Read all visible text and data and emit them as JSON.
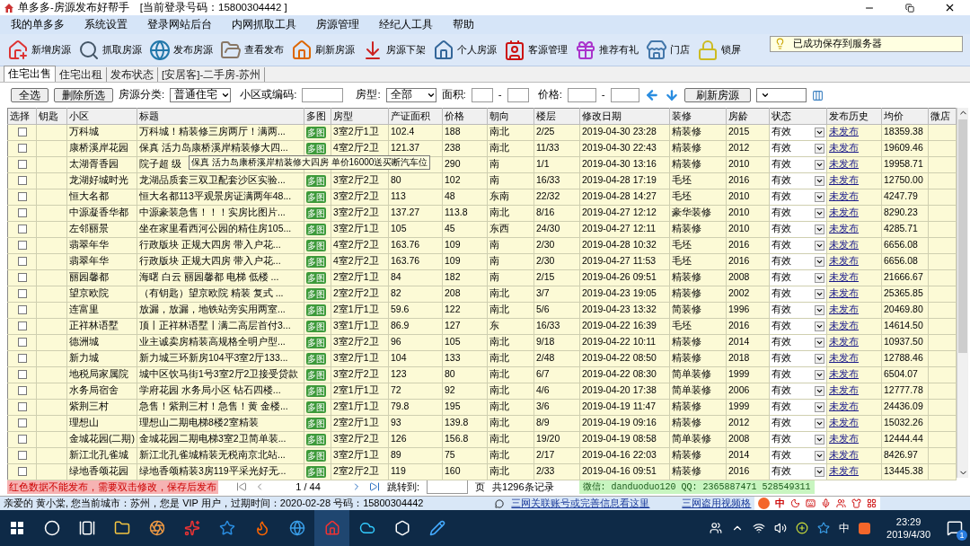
{
  "window": {
    "title": "单多多-房源发布好帮手",
    "login": "[当前登录号码：15800304442 ]"
  },
  "menu": [
    "我的单多多",
    "系统设置",
    "登录网站后台",
    "内网抓取工具",
    "房源管理",
    "经纪人工具",
    "帮助"
  ],
  "toolbar": [
    "新增房源",
    "抓取房源",
    "发布房源",
    "查看发布",
    "刷新房源",
    "房源下架",
    "个人房源",
    "客源管理",
    "推荐有礼",
    "门店",
    "锁屏"
  ],
  "notice": "已成功保存到服务器",
  "tabs": [
    {
      "label": "住宅出售",
      "selected": true
    },
    {
      "label": "住宅出租",
      "selected": false
    },
    {
      "label": "发布状态",
      "selected": false
    },
    {
      "label": "[安居客]-二手房-苏州",
      "selected": false
    }
  ],
  "filters": {
    "select_all": "全选",
    "delete": "删除所选",
    "category_label": "房源分类:",
    "category": "普通住宅",
    "community_label": "小区或编码:",
    "layout_label": "房型:",
    "layout": "全部",
    "area_label": "面积:",
    "area_sep": "-",
    "price_label": "价格:",
    "price_sep": "-",
    "refresh": "刷新房源"
  },
  "table": {
    "columns": [
      "选择",
      "钥匙",
      "小区",
      "标题",
      "多图",
      "房型",
      "产证面积",
      "价格",
      "朝向",
      "楼层",
      "修改日期",
      "装修",
      "房龄",
      "状态",
      "发布历史",
      "均价",
      "微店"
    ],
    "rows": [
      {
        "checked": false,
        "community": "万科城",
        "title": "万科城！精装修三房两厅！满两...",
        "multi": "多图",
        "layout": "3室2厅1卫",
        "area": "102.4",
        "price": "188",
        "facing": "南北",
        "floor": "2/25",
        "date": "2019-04-30 23:28",
        "decor": "精装修",
        "age": "2015",
        "status": "有效",
        "history": "未发布",
        "avg": "18359.38"
      },
      {
        "checked": false,
        "community": "康桥溪岸花园",
        "title": "保真 活力岛康桥溪岸精装修大四...",
        "multi": "多图",
        "layout": "4室2厅2卫",
        "area": "121.37",
        "price": "238",
        "facing": "南北",
        "floor": "11/33",
        "date": "2019-04-30 22:43",
        "decor": "精装修",
        "age": "2012",
        "status": "有效",
        "history": "未发布",
        "avg": "19609.46"
      },
      {
        "checked": false,
        "community": "太湖胥香园",
        "title": "院子超 级",
        "price": "290",
        "facing": "南",
        "floor": "1/1",
        "date": "2019-04-30 13:16",
        "decor": "精装修",
        "age": "2010",
        "status": "有效",
        "history": "未发布",
        "avg": "19958.71"
      },
      {
        "checked": false,
        "community": "龙湖好城时光",
        "title": "龙湖品质套三双卫配套沙区实验...",
        "multi": "多图",
        "layout": "3室2厅2卫",
        "area": "80",
        "price": "102",
        "facing": "南",
        "floor": "16/33",
        "date": "2019-04-28 17:19",
        "decor": "毛坯",
        "age": "2016",
        "status": "有效",
        "history": "未发布",
        "avg": "12750.00"
      },
      {
        "checked": false,
        "community": "恒大名都",
        "title": "恒大名都113平观景房证满两年48...",
        "multi": "多图",
        "layout": "3室2厅2卫",
        "area": "113",
        "price": "48",
        "facing": "东南",
        "floor": "22/32",
        "date": "2019-04-28 14:27",
        "decor": "毛坯",
        "age": "2010",
        "status": "有效",
        "history": "未发布",
        "avg": "4247.79"
      },
      {
        "checked": false,
        "community": "中源凝香华都",
        "title": "中源豪装急售！！！实房比图片...",
        "multi": "多图",
        "layout": "3室2厅2卫",
        "area": "137.27",
        "price": "113.8",
        "facing": "南北",
        "floor": "8/16",
        "date": "2019-04-27 12:12",
        "decor": "豪华装修",
        "age": "2010",
        "status": "有效",
        "history": "未发布",
        "avg": "8290.23"
      },
      {
        "checked": false,
        "community": "左邻丽景",
        "title": "坐在家里看西河公园的精住房105...",
        "multi": "多图",
        "layout": "3室2厅1卫",
        "area": "105",
        "price": "45",
        "facing": "东西",
        "floor": "24/30",
        "date": "2019-04-27 12:11",
        "decor": "精装修",
        "age": "2010",
        "status": "有效",
        "history": "未发布",
        "avg": "4285.71"
      },
      {
        "checked": false,
        "community": "翡翠年华",
        "title": "行政版块 正规大四房 带入户花...",
        "multi": "多图",
        "layout": "4室2厅2卫",
        "area": "163.76",
        "price": "109",
        "facing": "南",
        "floor": "2/30",
        "date": "2019-04-28 10:32",
        "decor": "毛坯",
        "age": "2016",
        "status": "有效",
        "history": "未发布",
        "avg": "6656.08"
      },
      {
        "checked": false,
        "community": "翡翠年华",
        "title": "行政版块 正规大四房 带入户花...",
        "multi": "多图",
        "layout": "4室2厅2卫",
        "area": "163.76",
        "price": "109",
        "facing": "南",
        "floor": "2/30",
        "date": "2019-04-27 11:53",
        "decor": "毛坯",
        "age": "2016",
        "status": "有效",
        "history": "未发布",
        "avg": "6656.08"
      },
      {
        "checked": false,
        "community": "丽园馨都",
        "title": "海曙 白云 丽园馨都 电梯 低楼 ...",
        "multi": "多图",
        "layout": "2室2厅1卫",
        "area": "84",
        "price": "182",
        "facing": "南",
        "floor": "2/15",
        "date": "2019-04-26 09:51",
        "decor": "精装修",
        "age": "2008",
        "status": "有效",
        "history": "未发布",
        "avg": "21666.67"
      },
      {
        "checked": false,
        "community": "望京欧院",
        "title": "（有钥匙）望京欧院 精装 复式 ...",
        "multi": "多图",
        "layout": "2室2厅2卫",
        "area": "82",
        "price": "208",
        "facing": "南北",
        "floor": "3/7",
        "date": "2019-04-23 19:05",
        "decor": "精装修",
        "age": "2002",
        "status": "有效",
        "history": "未发布",
        "avg": "25365.85"
      },
      {
        "checked": false,
        "community": "连富里",
        "title": "放漏，放漏，地铁站旁实用两室...",
        "multi": "多图",
        "layout": "2室1厅1卫",
        "area": "59.6",
        "price": "122",
        "facing": "南北",
        "floor": "5/6",
        "date": "2019-04-23 13:32",
        "decor": "简装修",
        "age": "1996",
        "status": "有效",
        "history": "未发布",
        "avg": "20469.80"
      },
      {
        "checked": false,
        "community": "正祥林语墅",
        "title": "顶丨正祥林语墅丨满二高层首付3...",
        "multi": "多图",
        "layout": "3室1厅1卫",
        "area": "86.9",
        "price": "127",
        "facing": "东",
        "floor": "16/33",
        "date": "2019-04-22 16:39",
        "decor": "毛坯",
        "age": "2016",
        "status": "有效",
        "history": "未发布",
        "avg": "14614.50"
      },
      {
        "checked": false,
        "community": "德洲城",
        "title": "业主诚卖房精装高规格全明户型...",
        "multi": "多图",
        "layout": "3室2厅2卫",
        "area": "96",
        "price": "105",
        "facing": "南北",
        "floor": "9/18",
        "date": "2019-04-22 10:11",
        "decor": "精装修",
        "age": "2014",
        "status": "有效",
        "history": "未发布",
        "avg": "10937.50"
      },
      {
        "checked": false,
        "community": "新力城",
        "title": "新力城三环新房104平3室2厅133...",
        "multi": "多图",
        "layout": "3室2厅1卫",
        "area": "104",
        "price": "133",
        "facing": "南北",
        "floor": "2/48",
        "date": "2019-04-22 08:50",
        "decor": "精装修",
        "age": "2018",
        "status": "有效",
        "history": "未发布",
        "avg": "12788.46"
      },
      {
        "checked": false,
        "community": "地税局家属院",
        "title": "城中区饮马街1号3室2厅2卫接受贷款",
        "multi": "多图",
        "layout": "3室2厅2卫",
        "area": "123",
        "price": "80",
        "facing": "南北",
        "floor": "6/7",
        "date": "2019-04-22 08:30",
        "decor": "简单装修",
        "age": "1999",
        "status": "有效",
        "history": "未发布",
        "avg": "6504.07"
      },
      {
        "checked": false,
        "community": "水务局宿舍",
        "title": "学府花园 水务局小区  钻石四楼...",
        "multi": "多图",
        "layout": "2室1厅1卫",
        "area": "72",
        "price": "92",
        "facing": "南北",
        "floor": "4/6",
        "date": "2019-04-20 17:38",
        "decor": "简单装修",
        "age": "2006",
        "status": "有效",
        "history": "未发布",
        "avg": "12777.78"
      },
      {
        "checked": false,
        "community": "紫荆三村",
        "title": "急售！紫荆三村！急售！黄 金楼...",
        "multi": "多图",
        "layout": "2室1厅1卫",
        "area": "79.8",
        "price": "195",
        "facing": "南北",
        "floor": "3/6",
        "date": "2019-04-19 11:47",
        "decor": "精装修",
        "age": "1999",
        "status": "有效",
        "history": "未发布",
        "avg": "24436.09"
      },
      {
        "checked": false,
        "community": "理想山",
        "title": "理想山二期电梯8楼2室精装",
        "multi": "多图",
        "layout": "2室2厅1卫",
        "area": "93",
        "price": "139.8",
        "facing": "南北",
        "floor": "8/9",
        "date": "2019-04-19 09:16",
        "decor": "精装修",
        "age": "2012",
        "status": "有效",
        "history": "未发布",
        "avg": "15032.26"
      },
      {
        "checked": false,
        "community": "金城花园(二期)",
        "title": "金城花园二期电梯3室2卫简单装...",
        "multi": "多图",
        "layout": "3室2厅2卫",
        "area": "126",
        "price": "156.8",
        "facing": "南北",
        "floor": "19/20",
        "date": "2019-04-19 08:58",
        "decor": "简单装修",
        "age": "2008",
        "status": "有效",
        "history": "未发布",
        "avg": "12444.44"
      },
      {
        "checked": false,
        "community": "新江北孔雀城",
        "title": "新江北孔雀城精装无税南京北站...",
        "multi": "多图",
        "layout": "3室2厅1卫",
        "area": "89",
        "price": "75",
        "facing": "南北",
        "floor": "2/17",
        "date": "2019-04-16 22:03",
        "decor": "精装修",
        "age": "2014",
        "status": "有效",
        "history": "未发布",
        "avg": "8426.97"
      },
      {
        "checked": false,
        "community": "绿地香颂花园",
        "title": "绿地香颂精装3房119平采光好无...",
        "multi": "多图",
        "layout": "2室2厅2卫",
        "area": "119",
        "price": "160",
        "facing": "南北",
        "floor": "2/33",
        "date": "2019-04-16 09:51",
        "decor": "精装修",
        "age": "2016",
        "status": "有效",
        "history": "未发布",
        "avg": "13445.38"
      }
    ]
  },
  "tooltip": "保真 活力岛康桥溪岸精装修大四房 单价16000送买断汽车位",
  "pager": {
    "note": "红色数据不能发布，需要双击修改，保存后发布",
    "page": "1 / 44",
    "goto_label": "跳转到:",
    "page_unit": "页",
    "total": "共1296条记录",
    "contact": "微信: danduoduo120 QQ: 2365887471 528549311"
  },
  "status_bar": {
    "text": "亲爱的 黄小棠, 您当前城市：苏州，您是 VIP 用户，过期时间：2020-02-28 号码：15800304442",
    "links": [
      "三网关联账号或完善信息看这里",
      "三网盗用视频格"
    ]
  },
  "ime_bar": {
    "mode": "中"
  },
  "taskbar": {
    "ime": "中",
    "time": "23:29",
    "date": "2019/4/30",
    "notifications": "1"
  }
}
